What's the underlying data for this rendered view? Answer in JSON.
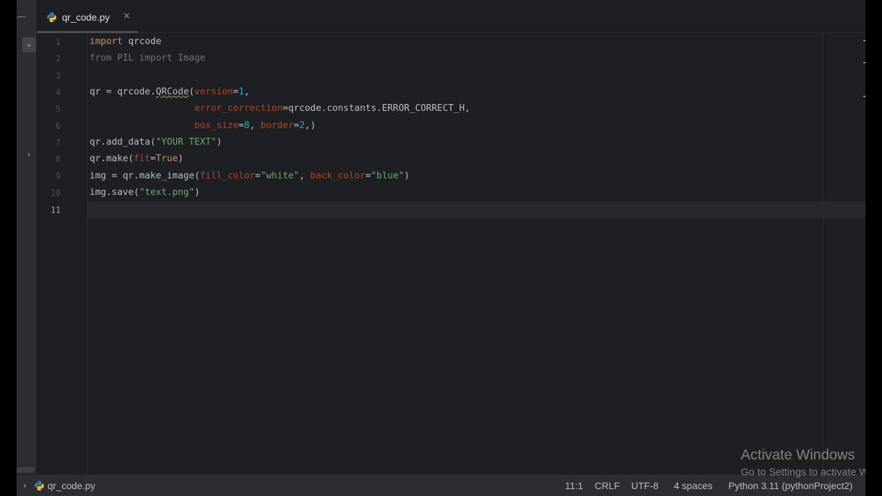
{
  "editor_tab": {
    "label": "qr_code.py",
    "icon": "python-file-icon",
    "close": "×"
  },
  "code_lines": [
    {
      "num": "1",
      "segments": [
        {
          "text": "import",
          "cls": "kw"
        },
        {
          "text": " qrcode",
          "cls": ""
        }
      ]
    },
    {
      "num": "2",
      "segments": [
        {
          "text": "from PIL import Image",
          "cls": "kw-dim"
        }
      ]
    },
    {
      "num": "3",
      "segments": []
    },
    {
      "num": "4",
      "segments": [
        {
          "text": "qr = qrcode.",
          "cls": ""
        },
        {
          "text": "QRCode",
          "cls": "squiggle"
        },
        {
          "text": "(",
          "cls": ""
        },
        {
          "text": "version",
          "cls": "param"
        },
        {
          "text": "=",
          "cls": ""
        },
        {
          "text": "1",
          "cls": "num"
        },
        {
          "text": ",",
          "cls": ""
        }
      ]
    },
    {
      "num": "5",
      "segments": [
        {
          "text": "                   ",
          "cls": ""
        },
        {
          "text": "error_correction",
          "cls": "param"
        },
        {
          "text": "=qrcode.constants.ERROR_CORRECT_H,",
          "cls": ""
        }
      ]
    },
    {
      "num": "6",
      "segments": [
        {
          "text": "                   ",
          "cls": ""
        },
        {
          "text": "box_size",
          "cls": "param"
        },
        {
          "text": "=",
          "cls": ""
        },
        {
          "text": "8",
          "cls": "num"
        },
        {
          "text": ", ",
          "cls": ""
        },
        {
          "text": "border",
          "cls": "param"
        },
        {
          "text": "=",
          "cls": ""
        },
        {
          "text": "2",
          "cls": "num"
        },
        {
          "text": ",)",
          "cls": ""
        }
      ]
    },
    {
      "num": "7",
      "segments": [
        {
          "text": "qr.add_data(",
          "cls": ""
        },
        {
          "text": "\"YOUR TEXT\"",
          "cls": "str"
        },
        {
          "text": ")",
          "cls": ""
        }
      ]
    },
    {
      "num": "8",
      "segments": [
        {
          "text": "qr.make(",
          "cls": ""
        },
        {
          "text": "fit",
          "cls": "param"
        },
        {
          "text": "=",
          "cls": ""
        },
        {
          "text": "True",
          "cls": "kw"
        },
        {
          "text": ")",
          "cls": ""
        }
      ]
    },
    {
      "num": "9",
      "segments": [
        {
          "text": "img = qr.make_image(",
          "cls": ""
        },
        {
          "text": "fill_color",
          "cls": "param"
        },
        {
          "text": "=",
          "cls": ""
        },
        {
          "text": "\"white\"",
          "cls": "str"
        },
        {
          "text": ", ",
          "cls": ""
        },
        {
          "text": "back_color",
          "cls": "param"
        },
        {
          "text": "=",
          "cls": ""
        },
        {
          "text": "\"blue\"",
          "cls": "str"
        },
        {
          "text": ")",
          "cls": ""
        }
      ]
    },
    {
      "num": "10",
      "segments": [
        {
          "text": "img.save(",
          "cls": ""
        },
        {
          "text": "\"text.png\"",
          "cls": "str"
        },
        {
          "text": ")",
          "cls": ""
        }
      ]
    },
    {
      "num": "11",
      "segments": [],
      "active": true
    }
  ],
  "status_bar": {
    "breadcrumb_file": "qr_code.py",
    "caret_position": "11:1",
    "line_separator": "CRLF",
    "encoding": "UTF-8",
    "indent": "4 spaces",
    "interpreter": "Python 3.11 (pythonProject2)"
  },
  "watermark": {
    "title": "Activate Windows",
    "subtitle": "Go to Settings to activate Windows."
  },
  "colors": {
    "editor_bg": "#1e1f22",
    "keyword": "#cf8e6d",
    "parameter": "#aa4926",
    "number": "#2aacb8",
    "string": "#6aab73"
  }
}
